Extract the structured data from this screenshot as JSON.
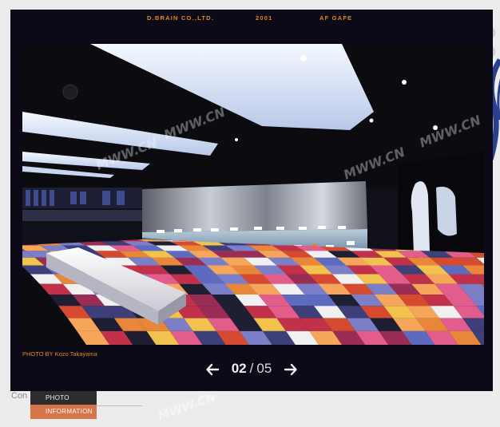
{
  "header": {
    "company": "D.BRAIN CO.,LTD.",
    "year": "2001",
    "project": "AF GAFE"
  },
  "photo": {
    "credit": "PHOTO BY Kozo Takayama",
    "watermarks": [
      "MWW.CN",
      "MWW.CN",
      "MWW.CN",
      "MWW.CN",
      "MWW.CN"
    ]
  },
  "pager": {
    "current": "02",
    "separator": "/",
    "total": "05",
    "prev_icon": "arrow-left-icon",
    "next_icon": "arrow-right-icon"
  },
  "page": {
    "partial_text": "Con"
  },
  "menu": {
    "photo_label": "PHOTO",
    "information_label": "INFORMATION"
  },
  "colors": {
    "accent_orange": "#e08a1e",
    "viewer_bg": "#0c0a16",
    "menu_active": "#d6744a",
    "menu_dark": "#2d2d2d"
  }
}
